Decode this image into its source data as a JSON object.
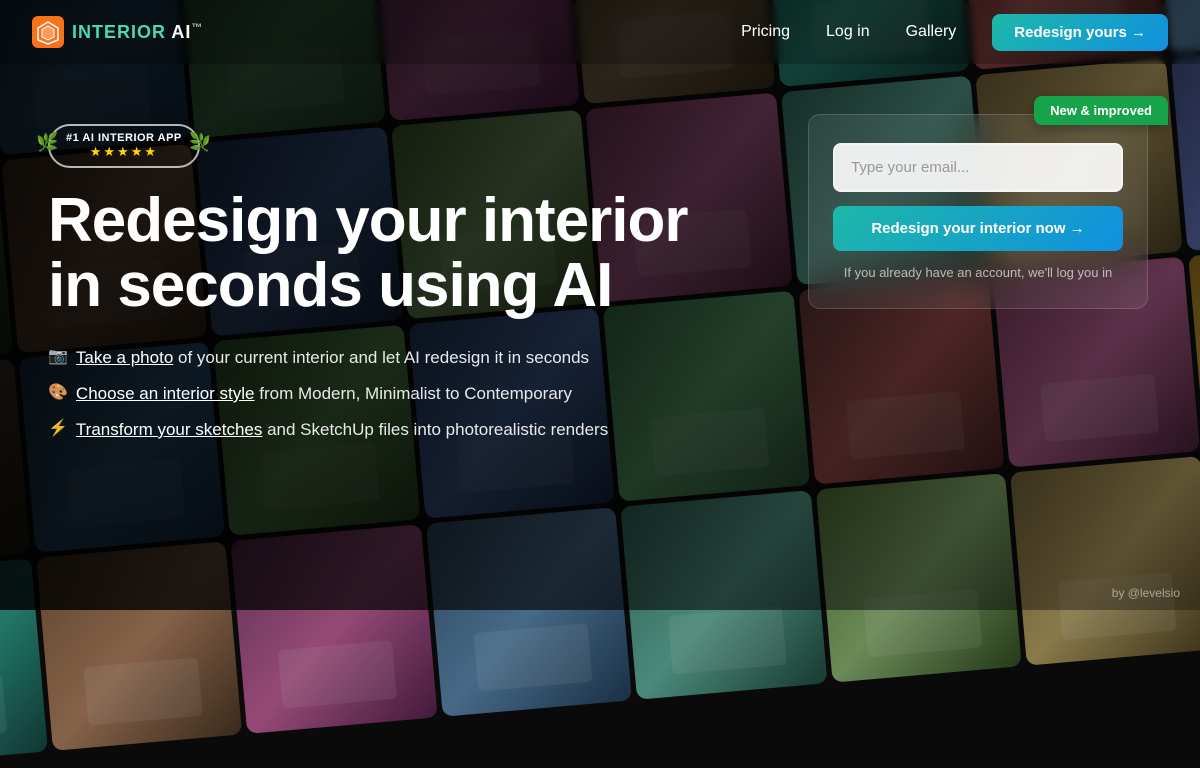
{
  "meta": {
    "title": "Interior AI - Redesign your interior in seconds using AI"
  },
  "logo": {
    "icon_label": "interior-ai-logo-icon",
    "text_interior": "INTERIOR",
    "text_ai": " AI",
    "trademark": "™"
  },
  "navbar": {
    "pricing_label": "Pricing",
    "login_label": "Log in",
    "gallery_label": "Gallery",
    "cta_label": "Redesign yours →"
  },
  "hero": {
    "badge": {
      "title": "#1 AI Interior App",
      "stars": "★★★★★"
    },
    "headline_line1": "Redesign your interior",
    "headline_line2": "in seconds using AI",
    "features": [
      {
        "icon": "📷",
        "link_text": "Take a photo",
        "rest_text": " of your current interior and let AI redesign it in seconds"
      },
      {
        "icon": "🎨",
        "link_text": "Choose an interior style",
        "rest_text": " from Modern, Minimalist to Contemporary"
      },
      {
        "icon": "⚡",
        "link_text": "Transform your sketches",
        "rest_text": " and SketchUp files into photorealistic renders"
      }
    ]
  },
  "signup_card": {
    "new_badge_text": "New & improved",
    "email_placeholder": "Type your email...",
    "cta_button_label": "Redesign your interior now →",
    "signin_note": "If you already have an account, we'll log you in"
  },
  "attribution": {
    "text": "by @levelsio"
  },
  "colors": {
    "accent_teal": "#1DB8A8",
    "accent_blue": "#1190E0",
    "green_badge": "#16A34A",
    "gold_stars": "#FFD700"
  }
}
